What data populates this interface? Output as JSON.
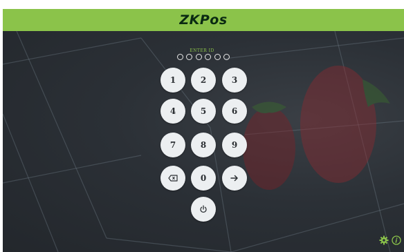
{
  "header": {
    "logo_text": "ZKPos",
    "background_color": "#8bc34a"
  },
  "login": {
    "enter_id_label": "ENTER ID",
    "pin_length": 6,
    "keys": [
      {
        "label": "1",
        "type": "digit"
      },
      {
        "label": "2",
        "type": "digit"
      },
      {
        "label": "3",
        "type": "digit"
      },
      {
        "label": "4",
        "type": "digit"
      },
      {
        "label": "5",
        "type": "digit"
      },
      {
        "label": "6",
        "type": "digit"
      },
      {
        "label": "7",
        "type": "digit"
      },
      {
        "label": "8",
        "type": "digit"
      },
      {
        "label": "9",
        "type": "digit"
      },
      {
        "label": "",
        "type": "backspace",
        "icon": "backspace-icon"
      },
      {
        "label": "0",
        "type": "digit"
      },
      {
        "label": "",
        "type": "enter",
        "icon": "arrow-right-icon"
      },
      {
        "label": "",
        "type": "power",
        "icon": "power-icon"
      }
    ]
  },
  "footer_icons": [
    {
      "icon": "gear-icon"
    },
    {
      "icon": "info-icon"
    }
  ],
  "colors": {
    "accent": "#8bc34a",
    "background": "#2b3036",
    "key_face": "#eceff1"
  }
}
